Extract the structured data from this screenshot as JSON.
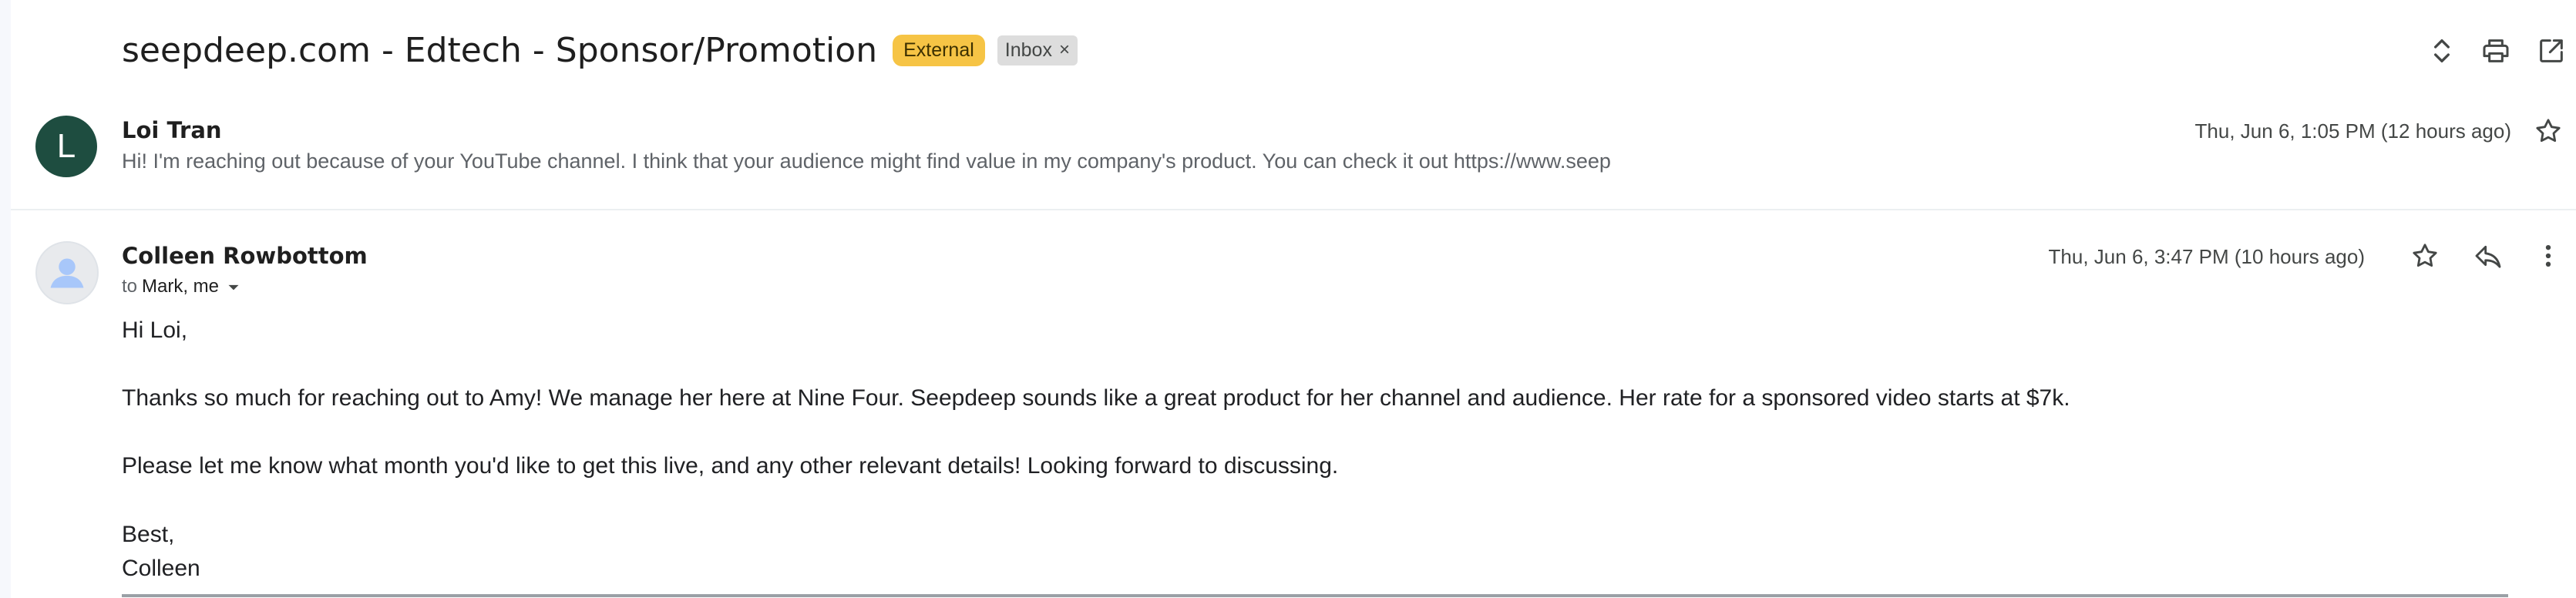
{
  "thread": {
    "subject": "seepdeep.com - Edtech - Sponsor/Promotion",
    "labels": {
      "external": "External",
      "inbox": "Inbox",
      "remove_glyph": "×"
    }
  },
  "messages": [
    {
      "avatar_letter": "L",
      "sender": "Loi Tran",
      "date": "Thu, Jun 6, 1:05 PM (12 hours ago)",
      "snippet": "Hi! I'm reaching out because of your YouTube channel. I think that your audience might find value in my company's product. You can check it out https://www.seep"
    },
    {
      "sender": "Colleen Rowbottom",
      "date": "Thu, Jun 6, 3:47 PM (10 hours ago)",
      "to_prefix": "to",
      "to_names": "Mark, me",
      "body": {
        "greeting": "Hi Loi,",
        "paragraph1": "Thanks so much for reaching out to Amy! We manage her here at Nine Four. Seepdeep sounds like a great product for her channel and audience. Her rate for a sponsored video starts at $7k.",
        "paragraph2": "Please let me know what month you'd like to get this live, and any other relevant details! Looking forward to discussing.",
        "signoff": "Best,",
        "signature": "Colleen"
      }
    }
  ],
  "icons": {
    "top": [
      "expand-all-icon",
      "print-icon",
      "open-in-new-window-icon"
    ],
    "message1": [
      "star-icon"
    ],
    "message2": [
      "star-icon",
      "reply-icon",
      "more-vert-icon",
      "dropdown-caret-icon"
    ]
  },
  "colors": {
    "external_label": "#f6c445",
    "inbox_label": "#dddddd",
    "avatar_l": "#1e4d40",
    "avatar_default": "#e8eaed",
    "avatar_person": "#a8c7fa"
  }
}
